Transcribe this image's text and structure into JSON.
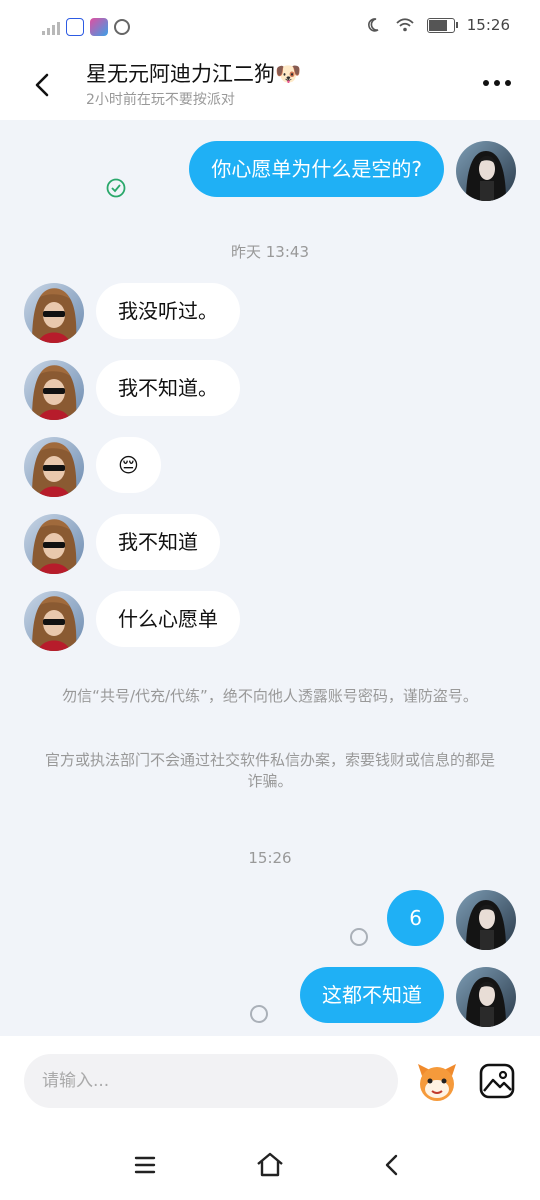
{
  "status_bar": {
    "time": "15:26",
    "icons": [
      "signal-icon",
      "baidu-app-icon",
      "game-app-icon",
      "settings-app-icon",
      "moon-icon",
      "wifi-icon",
      "battery-icon"
    ]
  },
  "header": {
    "title": "星无元阿迪力江二狗🐶",
    "subtitle": "2小时前在玩不要按派对",
    "back_icon": "back-arrow-icon",
    "more_icon": "more-dots-icon"
  },
  "chat": {
    "messages_top": [
      {
        "side": "out",
        "text": "你心愿单为什么是空的?",
        "status": "delivered"
      }
    ],
    "timestamp_1": "昨天 13:43",
    "incoming": [
      {
        "text": "我没听过。"
      },
      {
        "text": "我不知道。"
      },
      {
        "text": "😔"
      },
      {
        "text": "我不知道"
      },
      {
        "text": "什么心愿单"
      }
    ],
    "notice_1": "勿信“共号/代充/代练”，绝不向他人透露账号密码，谨防盗号。",
    "notice_2": "官方或执法部门不会通过社交软件私信办案，索要钱财或信息的都是诈骗。",
    "timestamp_2": "15:26",
    "outgoing_bottom": [
      {
        "text": "6",
        "status": "sending"
      },
      {
        "text": "这都不知道",
        "status": "sending"
      }
    ]
  },
  "input_bar": {
    "placeholder": "请输入...",
    "emoji_icon": "mascot-emoji-icon",
    "image_icon": "image-picker-icon"
  },
  "nav_bar": {
    "icons": [
      "menu-icon",
      "home-icon",
      "back-icon"
    ]
  },
  "colors": {
    "outgoing_bubble": "#1fb0f5",
    "chat_background": "#f1f4f9",
    "delivered_check": "#2aa86b"
  }
}
